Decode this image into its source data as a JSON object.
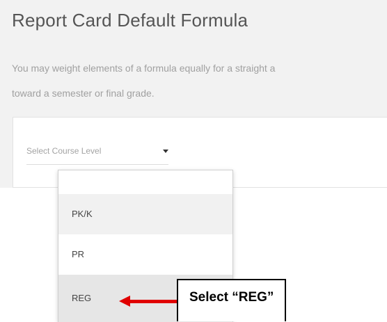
{
  "header": {
    "title": "Report Card Default Formula",
    "description_line1": "You may weight elements of a formula equally for a straight a",
    "description_line2": "toward a semester or final grade."
  },
  "course_level_select": {
    "placeholder": "Select Course Level",
    "options": [
      "",
      "PK/K",
      "PR",
      "REG"
    ],
    "highlighted_option": "REG"
  },
  "annotation": {
    "callout_text": "Select “REG”",
    "arrow_color": "#e00000"
  },
  "icons": {
    "select_caret": "caret-down-icon",
    "annotation_arrow": "arrow-left-icon"
  }
}
